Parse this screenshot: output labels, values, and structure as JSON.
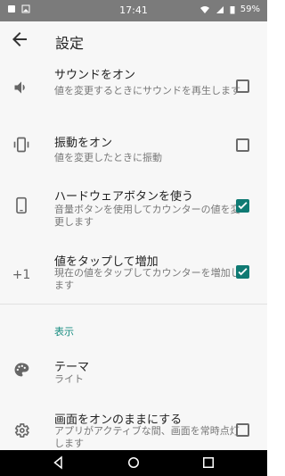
{
  "status_bar": {
    "time": "17:41",
    "battery": "59%"
  },
  "app_bar": {
    "title": "設定"
  },
  "items": [
    {
      "title": "サウンドをオン",
      "summary": "値を変更するときにサウンドを再生します",
      "icon": "volume-icon",
      "checked": false
    },
    {
      "title": "振動をオン",
      "summary": "値を変更したときに振動",
      "icon": "vibration-icon",
      "checked": false
    },
    {
      "title": "ハードウェアボタンを使う",
      "summary": "音量ボタンを使用してカウンターの値を変更します",
      "icon": "phone-icon",
      "checked": true
    },
    {
      "title": "値をタップして増加",
      "summary": "現在の値をタップしてカウンターを増加します",
      "icon": "plus-one-icon",
      "icon_text": "+1",
      "checked": true
    }
  ],
  "section": {
    "title": "表示"
  },
  "display_items": [
    {
      "title": "テーマ",
      "summary": "ライト",
      "icon": "palette-icon"
    },
    {
      "title": "画面をオンのままにする",
      "summary": "アプリがアクティブな間、画面を常時点灯します",
      "icon": "settings-icon",
      "checked": false
    }
  ],
  "colors": {
    "accent": "#0f7a73",
    "section_header": "#178c80"
  }
}
